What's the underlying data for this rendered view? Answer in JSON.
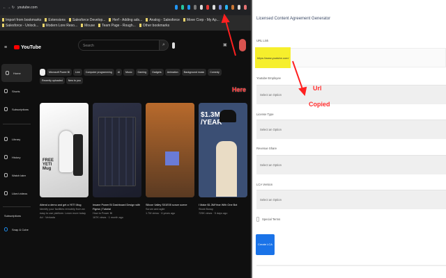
{
  "browser": {
    "url": "youtube.com",
    "bookmarks": [
      "Import from bookmarks",
      "Extensions",
      "Salesforce Develop...",
      "Herf - Adding ads...",
      "Analog - Salesforce",
      "Move Corp - My Ap...",
      "Salesforce - Unlock...",
      "Modern Lore Reso...",
      "Mouse",
      "Team Page - Rough...",
      "Other bookmarks"
    ]
  },
  "youtube": {
    "logo": "YouTube",
    "search_placeholder": "Search",
    "sidebar": [
      {
        "label": "Home"
      },
      {
        "label": "Shorts"
      },
      {
        "label": "Subscriptions"
      },
      {
        "label": "Library"
      },
      {
        "label": "History"
      },
      {
        "label": "Watch later"
      },
      {
        "label": "Liked videos"
      }
    ],
    "subscriptions_heading": "Subscriptions",
    "subscription": "Snap & Cube",
    "chips": [
      "All",
      "Microsoft Power BI",
      "Live",
      "Computer programming",
      "AI",
      "Music",
      "Gaming",
      "Gadgets",
      "Animation",
      "Background music",
      "Comedy",
      "Recently uploaded",
      "New to you"
    ],
    "videos": [
      {
        "title": "Attend a demo and get a YETI Mug",
        "line2": "Identify your facilities remotely from an easy to use platform. Learn more today",
        "line3": "Ad · Verkada",
        "thumb_text": "FREE YETI Mug"
      },
      {
        "title": "Insane Power BI Dashboard Design with Figma | Tutorial",
        "line2": "How to Power BI",
        "line3": "167K views · 1 month ago"
      },
      {
        "title": "Silicon Valley S01E05 scrum scene",
        "line2": "Scrum and agile",
        "line3": "1.7M views · 6 years ago"
      },
      {
        "title": "I Make $1.3M/Year With One Bot",
        "line2": "Stock Bossy",
        "line3": "729K views · 5 days ago",
        "thumb_text": "$1.3M /YEAR"
      }
    ]
  },
  "form": {
    "title": "Licensed Content Agreement Generator",
    "url_label": "URL Link",
    "url_value": "https://www.youtube.com/",
    "fields": [
      {
        "label": "Youtube Employee",
        "value": "Select an Option"
      },
      {
        "label": "License Type",
        "value": "Select an Option"
      },
      {
        "label": "Revenue Share",
        "value": "Select an Option"
      },
      {
        "label": "LCA Version",
        "value": "Select an Option"
      }
    ],
    "checkbox_label": "Special Terms",
    "submit": "Create LCA"
  },
  "annotations": {
    "here": "Here",
    "url_copied_1": "Url",
    "url_copied_2": "Copied"
  }
}
